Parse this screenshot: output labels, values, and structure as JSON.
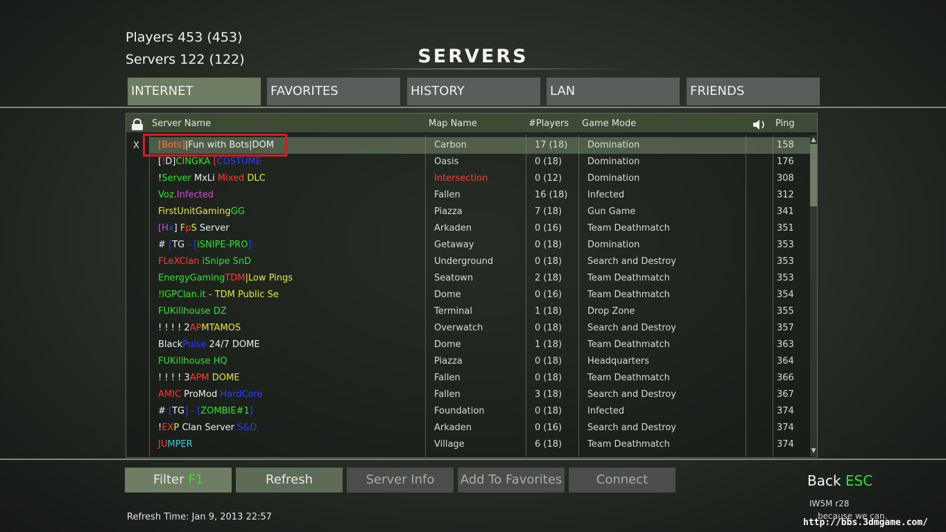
{
  "stats": {
    "players": "Players 453 (453)",
    "servers": "Servers 122 (122)"
  },
  "title": "SERVERS",
  "tabs": [
    {
      "label": "INTERNET",
      "active": true
    },
    {
      "label": "FAVORITES",
      "active": false
    },
    {
      "label": "HISTORY",
      "active": false
    },
    {
      "label": "LAN",
      "active": false
    },
    {
      "label": "FRIENDS",
      "active": false
    }
  ],
  "columns": {
    "name": "Server Name",
    "map": "Map Name",
    "players": "#Players",
    "mode": "Game Mode",
    "ping": "Ping"
  },
  "selection_mark": "X",
  "colors": {
    "white": "#eeeeee",
    "red": "#ff3b30",
    "green": "#2ee62e",
    "yellow": "#e8e83a",
    "blue": "#2b3bff",
    "magenta": "#d94ad9",
    "orange": "#ff7a2b",
    "cyan": "#29d0e0"
  },
  "rows": [
    {
      "name": [
        [
          "[Bots]",
          "orange"
        ],
        [
          "|Fun with Bots|DOM",
          "white"
        ]
      ],
      "map": "Carbon",
      "players": "17 (18)",
      "mode": "Domination",
      "ping": "158",
      "map_color": "",
      "selected": true
    },
    {
      "name": [
        [
          "[",
          "white"
        ],
        [
          "!",
          "red"
        ],
        [
          "D]",
          "white"
        ],
        [
          "CINGKA",
          "green"
        ],
        [
          " [",
          "red"
        ],
        [
          "COSTUME",
          "blue"
        ]
      ],
      "map": "Oasis",
      "players": "0 (18)",
      "mode": "Domination",
      "ping": "176"
    },
    {
      "name": [
        [
          "!",
          "white"
        ],
        [
          "Server",
          "green"
        ],
        [
          " MxLi ",
          "white"
        ],
        [
          "Mixed",
          "red"
        ],
        [
          " DLC",
          "yellow"
        ]
      ],
      "map": "Intersection",
      "players": "0 (12)",
      "mode": "Domination",
      "ping": "308",
      "map_color": "red"
    },
    {
      "name": [
        [
          "Voz.",
          "green"
        ],
        [
          "Infected",
          "magenta"
        ]
      ],
      "map": "Fallen",
      "players": "16 (18)",
      "mode": "Infected",
      "ping": "312"
    },
    {
      "name": [
        [
          "FirstUnitGaming",
          "yellow"
        ],
        [
          "GG",
          "green"
        ]
      ],
      "map": "Piazza",
      "players": "7 (18)",
      "mode": "Gun Game",
      "ping": "341"
    },
    {
      "name": [
        [
          "[H",
          "magenta"
        ],
        [
          "x",
          "blue"
        ],
        [
          "] ",
          "white"
        ],
        [
          "F",
          "yellow"
        ],
        [
          "p",
          "red"
        ],
        [
          "S",
          "yellow"
        ],
        [
          " Server",
          "white"
        ]
      ],
      "map": "Arkaden",
      "players": "0 (16)",
      "mode": "Team Deathmatch",
      "ping": "351"
    },
    {
      "name": [
        [
          "# ",
          "white"
        ],
        [
          "[",
          "blue"
        ],
        [
          "TG",
          "white"
        ],
        [
          " - [",
          "blue"
        ],
        [
          "iSNIPE-PRO",
          "green"
        ],
        [
          "]",
          "blue"
        ]
      ],
      "map": "Getaway",
      "players": "0 (18)",
      "mode": "Domination",
      "ping": "353"
    },
    {
      "name": [
        [
          "FLeXClan ",
          "red"
        ],
        [
          "iSnipe SnD",
          "green"
        ]
      ],
      "map": "Underground",
      "players": "0 (18)",
      "mode": "Search and Destroy",
      "ping": "353"
    },
    {
      "name": [
        [
          "EnergyGaming",
          "green"
        ],
        [
          "TDM",
          "red"
        ],
        [
          "|Low Pings",
          "yellow"
        ]
      ],
      "map": "Seatown",
      "players": "2 (18)",
      "mode": "Team Deathmatch",
      "ping": "353"
    },
    {
      "name": [
        [
          "!IGPClan.it",
          "green"
        ],
        [
          " - TDM Public Se",
          "yellow"
        ]
      ],
      "map": "Dome",
      "players": "0 (16)",
      "mode": "Team Deathmatch",
      "ping": "354"
    },
    {
      "name": [
        [
          "FUKillhouse DZ",
          "green"
        ]
      ],
      "map": "Terminal",
      "players": "1 (18)",
      "mode": "Drop Zone",
      "ping": "355"
    },
    {
      "name": [
        [
          "! ! ! ! 2",
          "white"
        ],
        [
          "AP",
          "red"
        ],
        [
          "M",
          "yellow"
        ],
        [
          "TAMOS",
          "yellow"
        ]
      ],
      "map": "Overwatch",
      "players": "0 (18)",
      "mode": "Search and Destroy",
      "ping": "357"
    },
    {
      "name": [
        [
          "Black",
          "white"
        ],
        [
          "Pulse",
          "blue"
        ],
        [
          " 24/7 DOME",
          "white"
        ]
      ],
      "map": "Dome",
      "players": "1 (18)",
      "mode": "Team Deathmatch",
      "ping": "363"
    },
    {
      "name": [
        [
          "FUKillhouse HQ",
          "green"
        ]
      ],
      "map": "Piazza",
      "players": "0 (18)",
      "mode": "Headquarters",
      "ping": "364"
    },
    {
      "name": [
        [
          "! ! ! ! 3",
          "white"
        ],
        [
          "APM",
          "red"
        ],
        [
          " DOME",
          "yellow"
        ]
      ],
      "map": "Fallen",
      "players": "0 (18)",
      "mode": "Team Deathmatch",
      "ping": "366"
    },
    {
      "name": [
        [
          "AMIC",
          "red"
        ],
        [
          " ProMod ",
          "white"
        ],
        [
          "HardCore",
          "blue"
        ]
      ],
      "map": "Fallen",
      "players": "3 (18)",
      "mode": "Search and Destroy",
      "ping": "367"
    },
    {
      "name": [
        [
          "# ",
          "white"
        ],
        [
          "[",
          "blue"
        ],
        [
          "TG",
          "white"
        ],
        [
          "] - [",
          "blue"
        ],
        [
          "ZOMBIE#1",
          "green"
        ],
        [
          "]",
          "blue"
        ]
      ],
      "map": "Foundation",
      "players": "0 (18)",
      "mode": "Infected",
      "ping": "374"
    },
    {
      "name": [
        [
          "!",
          "white"
        ],
        [
          "EX",
          "red"
        ],
        [
          "P",
          "yellow"
        ],
        [
          " Clan Server ",
          "white"
        ],
        [
          "S&D",
          "blue"
        ]
      ],
      "map": "Arkaden",
      "players": "0 (16)",
      "mode": "Search and Destroy",
      "ping": "374"
    },
    {
      "name": [
        [
          "JU",
          "red"
        ],
        [
          "MPER",
          "cyan"
        ]
      ],
      "map": "Village",
      "players": "6 (18)",
      "mode": "Team Deathmatch",
      "ping": "374"
    }
  ],
  "buttons": {
    "filter": "Filter",
    "filter_key": "F1",
    "refresh": "Refresh",
    "server_info": "Server Info",
    "add_fav": "Add To Favorites",
    "connect": "Connect"
  },
  "back": {
    "label": "Back",
    "key": "ESC"
  },
  "version": "IW5M r28",
  "tagline": "because we can.",
  "refresh_time": "Refresh Time: Jan 9, 2013   22:57",
  "watermark": "http://bbs.3dmgame.com/"
}
